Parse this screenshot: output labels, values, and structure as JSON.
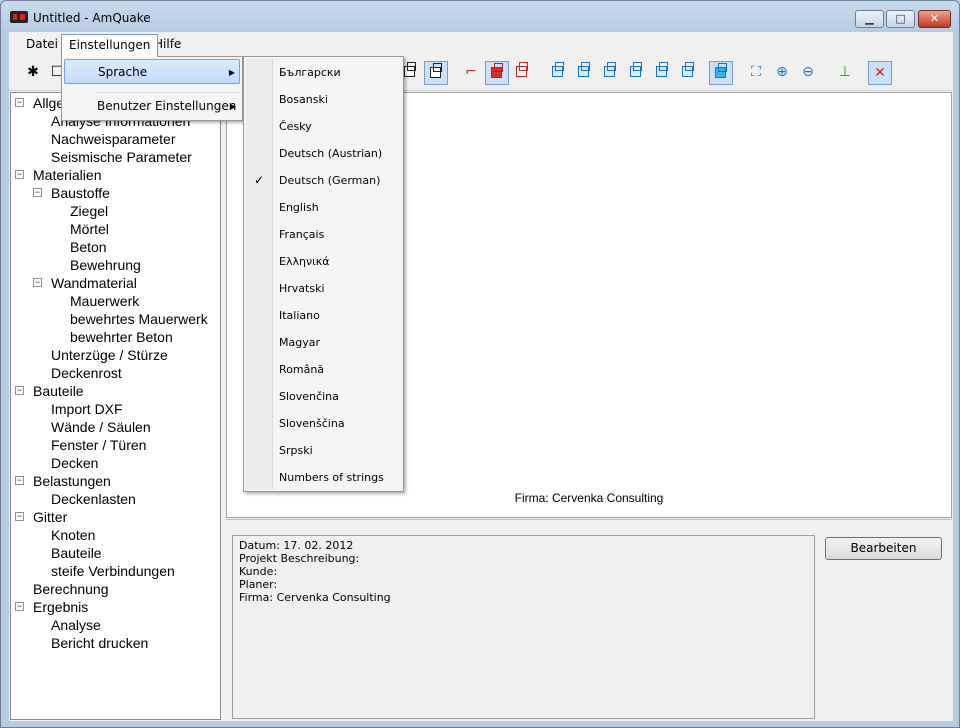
{
  "window": {
    "title": "Untitled - AmQuake"
  },
  "title_buttons": {
    "minimize": "▁",
    "maximize": "□",
    "close": "✕"
  },
  "menubar": {
    "items": [
      "Datei",
      "Einstellungen",
      "Hilfe"
    ]
  },
  "einstellungen_menu": {
    "items": [
      {
        "label": "Sprache",
        "has_submenu": true,
        "highlighted": true
      },
      {
        "label": "Benutzer Einstellungen",
        "has_submenu": true
      }
    ]
  },
  "sprache_submenu": {
    "items": [
      {
        "label": "Български",
        "checked": false
      },
      {
        "label": "Bosanski",
        "checked": false
      },
      {
        "label": "Česky",
        "checked": false
      },
      {
        "label": "Deutsch (Austrian)",
        "checked": false
      },
      {
        "label": "Deutsch (German)",
        "checked": true
      },
      {
        "label": "English",
        "checked": false
      },
      {
        "label": "Français",
        "checked": false
      },
      {
        "label": "Ελληνικά",
        "checked": false
      },
      {
        "label": "Hrvatski",
        "checked": false
      },
      {
        "label": "Italiano",
        "checked": false
      },
      {
        "label": "Magyar",
        "checked": false
      },
      {
        "label": "Română",
        "checked": false
      },
      {
        "label": "Slovenčina",
        "checked": false
      },
      {
        "label": "Slovenščina",
        "checked": false
      },
      {
        "label": "Srpski",
        "checked": false
      },
      {
        "label": "Numbers of strings",
        "checked": false
      }
    ]
  },
  "tree": {
    "nodes": [
      {
        "label": "Allgemein",
        "level": 0,
        "expander": "-"
      },
      {
        "label": "Analyse Informationen",
        "level": 1
      },
      {
        "label": "Nachweisparameter",
        "level": 1
      },
      {
        "label": "Seismische Parameter",
        "level": 1
      },
      {
        "label": "Materialien",
        "level": 0,
        "expander": "-"
      },
      {
        "label": "Baustoffe",
        "level": 1,
        "expander": "-"
      },
      {
        "label": "Ziegel",
        "level": 2
      },
      {
        "label": "Mörtel",
        "level": 2
      },
      {
        "label": "Beton",
        "level": 2
      },
      {
        "label": "Bewehrung",
        "level": 2
      },
      {
        "label": "Wandmaterial",
        "level": 1,
        "expander": "-"
      },
      {
        "label": "Mauerwerk",
        "level": 2
      },
      {
        "label": "bewehrtes Mauerwerk",
        "level": 2
      },
      {
        "label": "bewehrter Beton",
        "level": 2
      },
      {
        "label": "Unterzüge / Stürze",
        "level": 1
      },
      {
        "label": "Deckenrost",
        "level": 1
      },
      {
        "label": "Bauteile",
        "level": 0,
        "expander": "-"
      },
      {
        "label": "Import DXF",
        "level": 1
      },
      {
        "label": "Wände / Säulen",
        "level": 1
      },
      {
        "label": "Fenster / Türen",
        "level": 1
      },
      {
        "label": "Decken",
        "level": 1
      },
      {
        "label": "Belastungen",
        "level": 0,
        "expander": "-"
      },
      {
        "label": "Deckenlasten",
        "level": 1
      },
      {
        "label": "Gitter",
        "level": 0,
        "expander": "-"
      },
      {
        "label": "Knoten",
        "level": 1
      },
      {
        "label": "Bauteile",
        "level": 1
      },
      {
        "label": "steife Verbindungen",
        "level": 1
      },
      {
        "label": "Berechnung",
        "level": 0
      },
      {
        "label": "Ergebnis",
        "level": 0,
        "expander": "-"
      },
      {
        "label": "Analyse",
        "level": 1
      },
      {
        "label": "Bericht drucken",
        "level": 1
      }
    ]
  },
  "canvas": {
    "firma_label": "Firma: Cervenka Consulting"
  },
  "info_panel": {
    "lines": [
      "Datum: 17. 02. 2012",
      "Projekt Beschreibung:",
      "Kunde:",
      "Planer:",
      "Firma: Cervenka Consulting"
    ]
  },
  "edit_button": {
    "label": "Bearbeiten"
  },
  "toolbar": {
    "icons": [
      "bug-icon",
      "select-icon",
      "wireframe-cube-icon",
      "wireframe-cube-active-icon",
      "axis-red-icon",
      "solid-red-cube-icon",
      "red-outline-cube-icon",
      "view-front-icon",
      "view-back-icon",
      "view-left-icon",
      "view-right-icon",
      "view-top-icon",
      "view-bottom-icon",
      "view-iso-icon",
      "zoom-fit-icon",
      "zoom-in-icon",
      "zoom-out-icon",
      "axes-icon",
      "cross-tool-icon"
    ]
  },
  "colors": {
    "accent": "#7da2ce",
    "cube_blue": "#1a70c8",
    "cube_red": "#d83030"
  }
}
